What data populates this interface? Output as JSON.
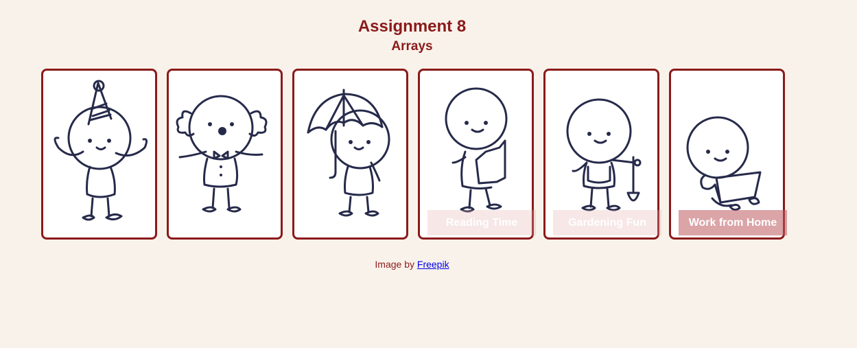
{
  "header": {
    "title": "Assignment 8",
    "subtitle": "Arrays"
  },
  "cards": [
    {
      "figure": "party-hat-figure",
      "caption": ""
    },
    {
      "figure": "clown-figure",
      "caption": ""
    },
    {
      "figure": "umbrella-figure",
      "caption": ""
    },
    {
      "figure": "reading-figure",
      "caption": "Reading Time"
    },
    {
      "figure": "gardening-figure",
      "caption": "Gardening Fun"
    },
    {
      "figure": "laptop-figure",
      "caption": "Work from Home"
    }
  ],
  "footer": {
    "prefix": "Image by ",
    "link_text": "Freepik"
  },
  "colors": {
    "background": "#f8f2eb",
    "accent": "#8b1a1a",
    "ink": "#262a4a",
    "link": "#0000ee"
  }
}
